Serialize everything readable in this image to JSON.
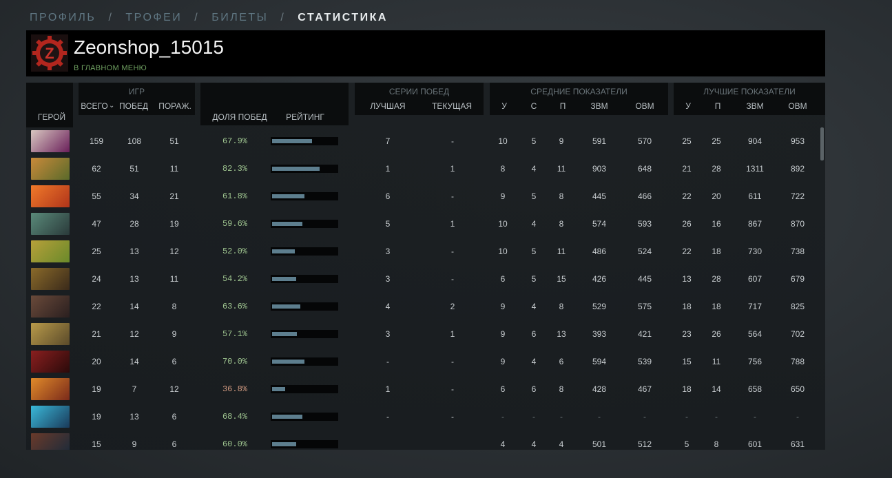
{
  "nav": {
    "items": [
      {
        "label": "ПРОФИЛЬ",
        "active": false
      },
      {
        "label": "ТРОФЕИ",
        "active": false
      },
      {
        "label": "БИЛЕТЫ",
        "active": false
      },
      {
        "label": "СТАТИСТИКА",
        "active": true
      }
    ],
    "separator": "/"
  },
  "player": {
    "name": "Zeonshop_15015",
    "status": "В ГЛАВНОМ МЕНЮ",
    "avatar_icon": "gear-z-logo",
    "avatar_letter": "Z"
  },
  "table": {
    "headers": {
      "hero": "ГЕРОЙ",
      "games_group": "ИГР",
      "total": "ВСЕГО",
      "wins": "ПОБЕД",
      "losses": "ПОРАЖ.",
      "winrate": "ДОЛЯ ПОБЕД",
      "rating": "РЕЙТИНГ",
      "streak_group": "СЕРИИ ПОБЕД",
      "best": "ЛУЧШАЯ",
      "current": "ТЕКУЩАЯ",
      "avg_group": "СРЕДНИЕ ПОКАЗАТЕЛИ",
      "avg_k": "У",
      "avg_d": "С",
      "avg_a": "П",
      "avg_gpm": "ЗВМ",
      "avg_xpm": "ОВМ",
      "best_group": "ЛУЧШИЕ ПОКАЗАТЕЛИ",
      "best_k": "У",
      "best_a": "П",
      "best_gpm": "ЗВМ",
      "best_xpm": "ОВМ"
    },
    "sort_icon": "chevron-down-icon",
    "rows": [
      {
        "hero": "invoker",
        "total": "159",
        "wins": "108",
        "losses": "51",
        "winrate": "67.9%",
        "rating": 0.62,
        "best": "7",
        "current": "-",
        "k": "10",
        "d": "5",
        "a": "9",
        "gpm": "591",
        "xpm": "570",
        "bk": "25",
        "ba": "25",
        "bgpm": "904",
        "bxpm": "953"
      },
      {
        "hero": "meepo-pair",
        "total": "62",
        "wins": "51",
        "losses": "11",
        "winrate": "82.3%",
        "rating": 0.73,
        "best": "1",
        "current": "1",
        "k": "8",
        "d": "4",
        "a": "11",
        "gpm": "903",
        "xpm": "648",
        "bk": "21",
        "ba": "28",
        "bgpm": "1311",
        "bxpm": "892"
      },
      {
        "hero": "lina",
        "total": "55",
        "wins": "34",
        "losses": "21",
        "winrate": "61.8%",
        "rating": 0.5,
        "best": "6",
        "current": "-",
        "k": "9",
        "d": "5",
        "a": "8",
        "gpm": "445",
        "xpm": "466",
        "bk": "22",
        "ba": "20",
        "bgpm": "611",
        "bxpm": "722"
      },
      {
        "hero": "tidehunter",
        "total": "47",
        "wins": "28",
        "losses": "19",
        "winrate": "59.6%",
        "rating": 0.47,
        "best": "5",
        "current": "1",
        "k": "10",
        "d": "4",
        "a": "8",
        "gpm": "574",
        "xpm": "593",
        "bk": "26",
        "ba": "16",
        "bgpm": "867",
        "bxpm": "870"
      },
      {
        "hero": "windranger",
        "total": "25",
        "wins": "13",
        "losses": "12",
        "winrate": "52.0%",
        "rating": 0.35,
        "best": "3",
        "current": "-",
        "k": "10",
        "d": "5",
        "a": "11",
        "gpm": "486",
        "xpm": "524",
        "bk": "22",
        "ba": "18",
        "bgpm": "730",
        "bxpm": "738"
      },
      {
        "hero": "sand-king",
        "total": "24",
        "wins": "13",
        "losses": "11",
        "winrate": "54.2%",
        "rating": 0.37,
        "best": "3",
        "current": "-",
        "k": "6",
        "d": "5",
        "a": "15",
        "gpm": "426",
        "xpm": "445",
        "bk": "13",
        "ba": "28",
        "bgpm": "607",
        "bxpm": "679"
      },
      {
        "hero": "ursa",
        "total": "22",
        "wins": "14",
        "losses": "8",
        "winrate": "63.6%",
        "rating": 0.44,
        "best": "4",
        "current": "2",
        "k": "9",
        "d": "4",
        "a": "8",
        "gpm": "529",
        "xpm": "575",
        "bk": "18",
        "ba": "18",
        "bgpm": "717",
        "bxpm": "825"
      },
      {
        "hero": "alchemist",
        "total": "21",
        "wins": "12",
        "losses": "9",
        "winrate": "57.1%",
        "rating": 0.38,
        "best": "3",
        "current": "1",
        "k": "9",
        "d": "6",
        "a": "13",
        "gpm": "393",
        "xpm": "421",
        "bk": "23",
        "ba": "26",
        "bgpm": "564",
        "bxpm": "702"
      },
      {
        "hero": "shadow-fiend",
        "total": "20",
        "wins": "14",
        "losses": "6",
        "winrate": "70.0%",
        "rating": 0.5,
        "best": "-",
        "current": "-",
        "k": "9",
        "d": "4",
        "a": "6",
        "gpm": "594",
        "xpm": "539",
        "bk": "15",
        "ba": "11",
        "bgpm": "756",
        "bxpm": "788"
      },
      {
        "hero": "ember-spirit",
        "total": "19",
        "wins": "7",
        "losses": "12",
        "winrate": "36.8%",
        "rating": 0.2,
        "best": "1",
        "current": "-",
        "k": "6",
        "d": "6",
        "a": "8",
        "gpm": "428",
        "xpm": "467",
        "bk": "18",
        "ba": "14",
        "bgpm": "658",
        "bxpm": "650"
      },
      {
        "hero": "arc-warden",
        "total": "19",
        "wins": "13",
        "losses": "6",
        "winrate": "68.4%",
        "rating": 0.47,
        "best": "-",
        "current": "-",
        "k": "-",
        "d": "-",
        "a": "-",
        "gpm": "-",
        "xpm": "-",
        "bk": "-",
        "ba": "-",
        "bgpm": "-",
        "bxpm": "-"
      },
      {
        "hero": "troll-warlord",
        "total": "15",
        "wins": "9",
        "losses": "6",
        "winrate": "60.0%",
        "rating": 0.37,
        "best": "",
        "current": "",
        "k": "4",
        "d": "4",
        "a": "4",
        "gpm": "501",
        "xpm": "512",
        "bk": "5",
        "ba": "8",
        "bgpm": "601",
        "bxpm": "631"
      }
    ]
  },
  "colors": {
    "winrate_text": "#9ec48f",
    "rating_bar": "#5d7e8e",
    "status_green": "#6fa061",
    "accent_red": "#c0392b"
  }
}
